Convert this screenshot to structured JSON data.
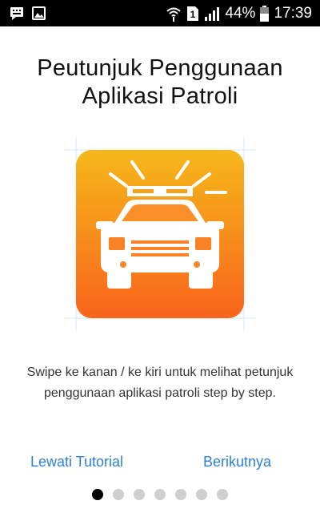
{
  "status_bar": {
    "icons_left": [
      "chat-notification-icon",
      "image-notification-icon"
    ],
    "icons_right": [
      "wifi-icon",
      "sim-1-icon",
      "signal-icon",
      "battery-icon"
    ],
    "sim_label": "1",
    "battery_percent": "44%",
    "time": "17:39"
  },
  "title": {
    "line1": "Peutunjuk Penggunaan",
    "line2": "Aplikasi Patroli"
  },
  "illustration": {
    "icon": "police-car-icon",
    "gradient_top": "#f6b81a",
    "gradient_bottom": "#f8641c"
  },
  "description": {
    "line1": "Swipe ke kanan / ke kiri untuk melihat petunjuk",
    "line2": "penggunaan aplikasi patroli step by step."
  },
  "nav": {
    "skip_label": "Lewati Tutorial",
    "next_label": "Berikutnya",
    "accent_color": "#2f80d8"
  },
  "pager": {
    "total_pages": 7,
    "current_page": 1
  }
}
